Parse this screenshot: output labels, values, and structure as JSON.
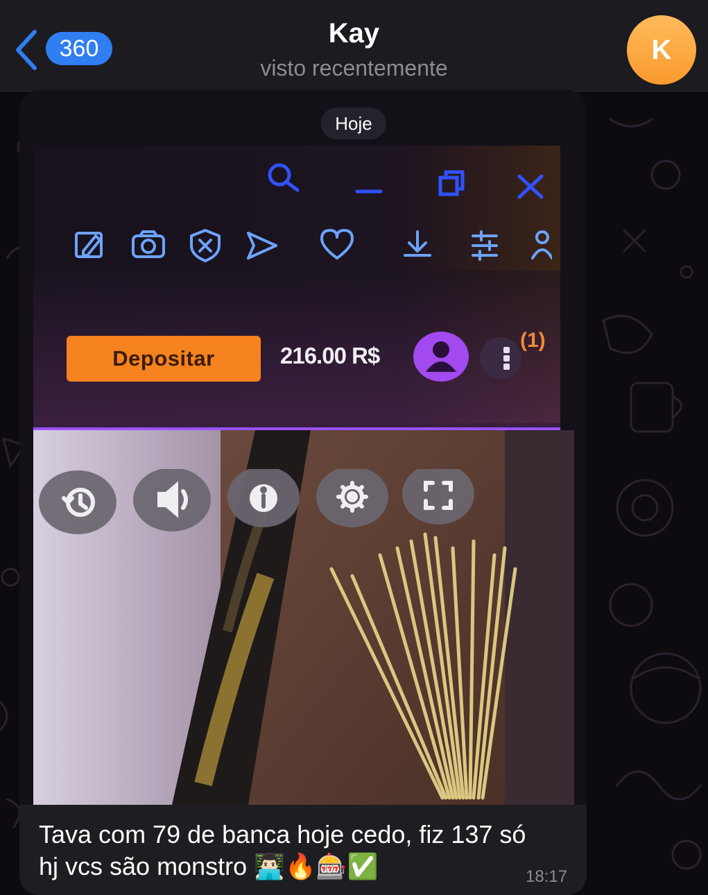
{
  "header": {
    "back_count": "360",
    "title": "Kay",
    "status": "visto recentemente",
    "avatar_initial": "K"
  },
  "date_separator": "Hoje",
  "message": {
    "caption_line1": "Tava com 79 de banca hoje cedo, fiz 137 só",
    "caption_line2": "hj vcs são monstro 👨🏻‍💻🔥🎰✅",
    "time": "18:17"
  },
  "photo": {
    "deposit_label": "Depositar",
    "balance": "216.00 R$",
    "notification_badge": "(1)",
    "toolbar_icons": [
      "search-icon",
      "minimize-icon",
      "restore-icon",
      "close-icon"
    ],
    "action_icons": [
      "edit-icon",
      "camera-icon",
      "shield-x-icon",
      "send-icon",
      "heart-icon",
      "download-icon",
      "sliders-icon",
      "user-icon"
    ],
    "game_controls": [
      "history-icon",
      "volume-icon",
      "info-icon",
      "settings-icon",
      "fullscreen-icon"
    ]
  },
  "colors": {
    "header_bg": "#1c1b20",
    "badge_blue": "#2f7ef2",
    "avatar_orange": "#f99a2c",
    "deposit_orange": "#f6831f",
    "profile_purple": "#a24af0",
    "screen_icon_blue": "#2f52ff"
  }
}
